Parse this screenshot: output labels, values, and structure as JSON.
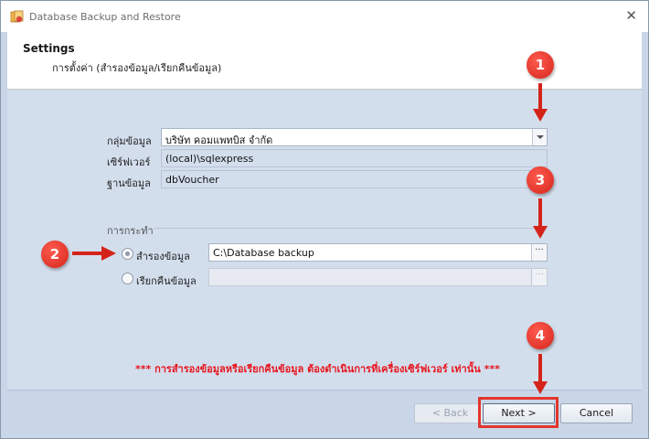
{
  "window": {
    "title": "Database Backup and Restore"
  },
  "header": {
    "title": "Settings",
    "subtitle": "การตั้งค่า (สำรองข้อมูล/เรียกคืนข้อมูล)"
  },
  "form": {
    "group": {
      "label": "กลุ่มข้อมูล",
      "value": "บริษัท คอมแพทบิส จำกัด"
    },
    "server": {
      "label": "เซิร์ฟเวอร์",
      "value": "(local)\\sqlexpress"
    },
    "database": {
      "label": "ฐานข้อมูล",
      "value": "dbVoucher"
    }
  },
  "action": {
    "group_label": "การกระทำ",
    "backup": {
      "label": "สำรองข้อมูล",
      "path": "C:\\Database backup",
      "selected": true
    },
    "restore": {
      "label": "เรียกคืนข้อมูล",
      "path": "",
      "selected": false
    }
  },
  "ellipsis": "···",
  "warning": "*** การสำรองข้อมูลหรือเรียกคืนข้อมูล ต้องดำเนินการที่เครื่องเซิร์ฟเวอร์ เท่านั้น ***",
  "buttons": {
    "back": "< Back",
    "next": "Next >",
    "cancel": "Cancel"
  },
  "callouts": [
    "1",
    "2",
    "3",
    "4"
  ],
  "colors": {
    "callout": "#d4241a",
    "warning": "#e8141c",
    "highlight": "#e2362b"
  }
}
